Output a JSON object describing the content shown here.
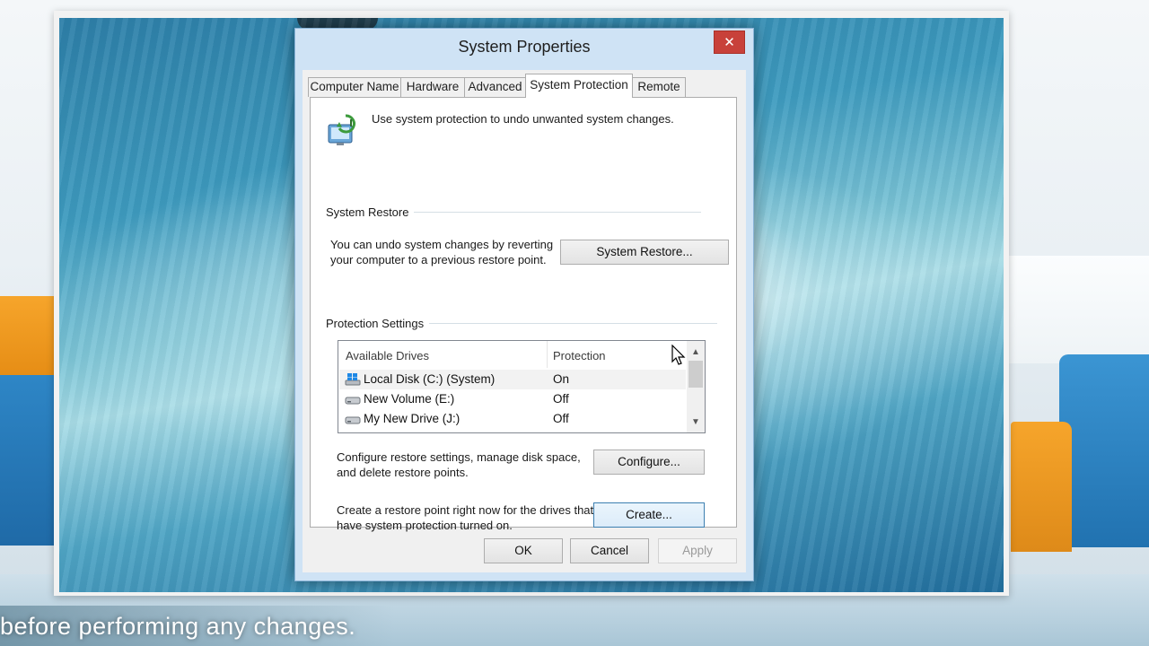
{
  "dialog": {
    "title": "System Properties",
    "close_glyph": "✕",
    "tabs": [
      {
        "label": "Computer Name"
      },
      {
        "label": "Hardware"
      },
      {
        "label": "Advanced"
      },
      {
        "label": "System Protection",
        "active": true
      },
      {
        "label": "Remote"
      }
    ],
    "intro_text": "Use system protection to undo unwanted system changes.",
    "system_restore": {
      "group_label": "System Restore",
      "description_line1": "You can undo system changes by reverting",
      "description_line2": "your computer to a previous restore point.",
      "button_label": "System Restore..."
    },
    "protection_settings": {
      "group_label": "Protection Settings",
      "columns": [
        "Available Drives",
        "Protection"
      ],
      "drives": [
        {
          "name": "Local Disk (C:) (System)",
          "protection": "On",
          "icon": "system-drive-icon"
        },
        {
          "name": "New Volume (E:)",
          "protection": "Off",
          "icon": "drive-icon"
        },
        {
          "name": "My New Drive (J:)",
          "protection": "Off",
          "icon": "drive-icon"
        }
      ],
      "configure_line1": "Configure restore settings, manage disk space,",
      "configure_line2": "and delete restore points.",
      "configure_button": "Configure...",
      "create_line1": "Create a restore point right now for the drives that",
      "create_line2": "have system protection turned on.",
      "create_button": "Create..."
    },
    "footer": {
      "ok": "OK",
      "cancel": "Cancel",
      "apply": "Apply"
    }
  },
  "caption": "before performing any changes.",
  "colors": {
    "close_button": "#c8413a",
    "accent": "#3c7fb1"
  }
}
